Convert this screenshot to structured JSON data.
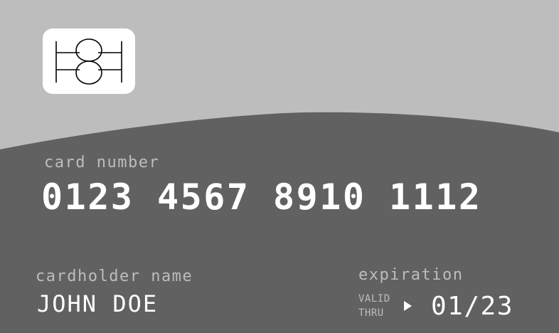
{
  "colors": {
    "card_top": "#bdbdbd",
    "card_bottom": "#616161",
    "text_primary": "#ffffff",
    "text_muted": "#bdbdbd"
  },
  "chip": {
    "icon": "chip-icon"
  },
  "card_number": {
    "label": "card number",
    "value": "0123 4567 8910 1112"
  },
  "cardholder": {
    "label": "cardholder name",
    "value": "JOHN DOE"
  },
  "expiration": {
    "label": "expiration",
    "valid_line1": "VALID",
    "valid_line2": "THRU",
    "arrow_icon": "play-arrow-icon",
    "value": "01/23"
  }
}
